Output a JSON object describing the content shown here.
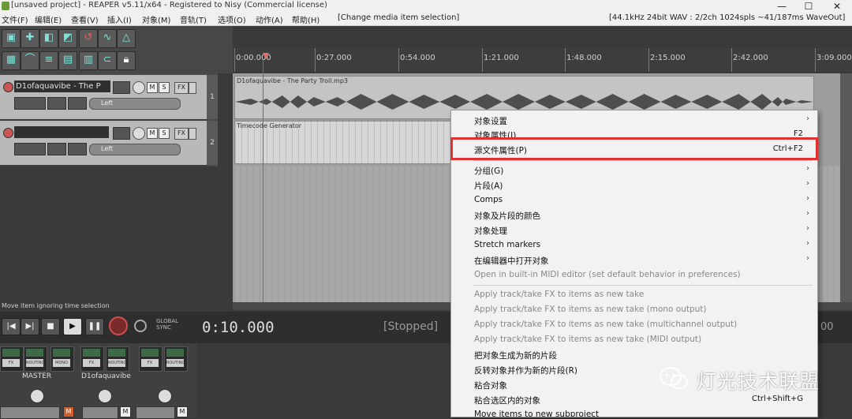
{
  "window": {
    "title": "[unsaved project] - REAPER v5.11/x64 - Registered to Nisy (Commercial license)",
    "min_icon": "minimize-icon",
    "max_icon": "maximize-icon",
    "close_icon": "close-icon",
    "min_glyph": "—",
    "max_glyph": "☐",
    "close_glyph": "✕"
  },
  "menubar": {
    "items": [
      "文件(F)",
      "编辑(E)",
      "查看(V)",
      "插入(I)",
      "对象(M)",
      "音轨(T)",
      "选项(O)",
      "动作(A)",
      "帮助(H)"
    ],
    "last_action": "[Change media item selection]",
    "audio_status": "[44.1kHz 24bit WAV : 2/2ch 1024spls ~41/187ms WaveOut]"
  },
  "ruler": {
    "ticks": [
      "0:00.000",
      "0:27.000",
      "0:54.000",
      "1:21.000",
      "1:48.000",
      "2:15.000",
      "2:42.000",
      "3:09.000"
    ]
  },
  "tracks": [
    {
      "name": "D1ofaquavibe - The P",
      "number": "1",
      "m": "M",
      "s": "S",
      "fx": "FX",
      "pan": "Left"
    },
    {
      "name": "",
      "number": "2",
      "m": "M",
      "s": "S",
      "fx": "FX",
      "pan": "Left"
    }
  ],
  "items": {
    "item1_label": "D1ofaquavibe - The Party Troll.mp3",
    "item2_label": "Timecode Generator"
  },
  "status_strip": "Move item ignoring time selection",
  "transport": {
    "time": "0:10.000",
    "state": "[Stopped]",
    "right_value": "00",
    "global_label": "GLOBAL",
    "sync_label": "SYNC",
    "rewind": "|◀",
    "forward": "▶|",
    "stop": "■",
    "play": "▶",
    "pause": "❚❚"
  },
  "mixer": {
    "master_label": "MASTER",
    "track_label": "D1ofaquavibe",
    "m": "M",
    "routing": "ROUTING",
    "mono": "MONO"
  },
  "context_menu": {
    "items": [
      {
        "label": "对象设置",
        "arrow": true
      },
      {
        "label": "对象属性(I)",
        "shortcut": "F2"
      },
      {
        "label": "源文件属性(P)",
        "shortcut": "Ctrl+F2",
        "highlighted": true
      },
      {
        "sep": true
      },
      {
        "label": "分组(G)",
        "arrow": true
      },
      {
        "label": "片段(A)",
        "arrow": true
      },
      {
        "label": "Comps",
        "arrow": true
      },
      {
        "label": "对象及片段的颜色",
        "arrow": true
      },
      {
        "label": "对象处理",
        "arrow": true
      },
      {
        "label": "Stretch markers",
        "arrow": true
      },
      {
        "label": "在编辑器中打开对象",
        "arrow": true
      },
      {
        "label": "Open in built-in MIDI editor (set default behavior in preferences)",
        "disabled": true
      },
      {
        "sep": true
      },
      {
        "label": "Apply track/take FX to items as new take",
        "disabled": true
      },
      {
        "label": "Apply track/take FX to items as new take (mono output)",
        "disabled": true
      },
      {
        "label": "Apply track/take FX to items as new take (multichannel output)",
        "disabled": true
      },
      {
        "label": "Apply track/take FX to items as new take (MIDI output)",
        "disabled": true
      },
      {
        "label": "把对象生成为新的片段"
      },
      {
        "label": "反转对象并作为新的片段(R)"
      },
      {
        "label": "粘合对象"
      },
      {
        "label": "粘合选区内的对象",
        "shortcut": "Ctrl+Shift+G"
      },
      {
        "label": "Move items to new subproject"
      }
    ]
  },
  "watermark": {
    "text": "灯光技术联盟"
  },
  "colors": {
    "accent_cyan": "#7fe0d6",
    "highlight_red": "#e03030",
    "record_red": "#d05050"
  }
}
